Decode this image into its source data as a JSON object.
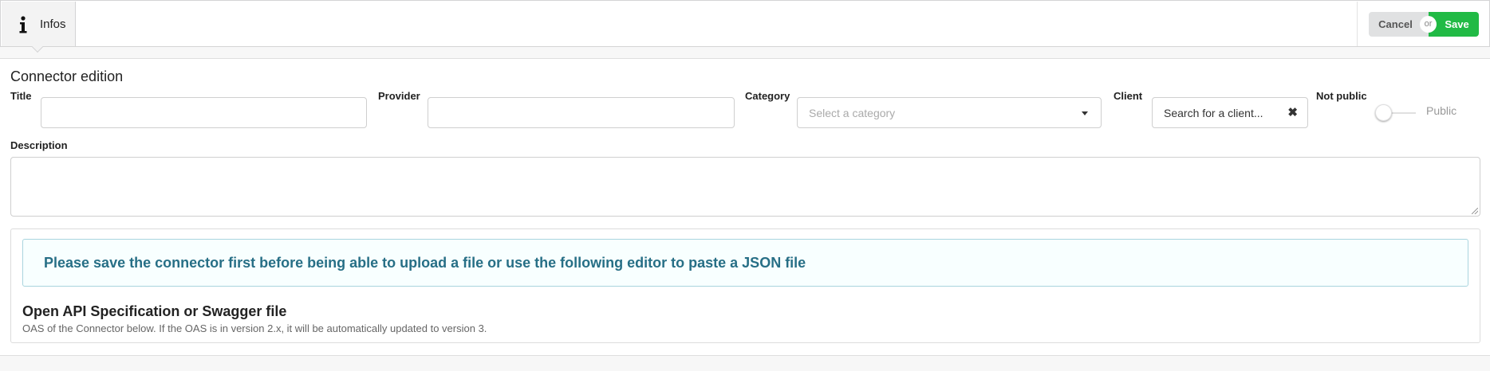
{
  "header": {
    "tabs": [
      {
        "label": "Infos",
        "icon": "info-icon",
        "active": true
      }
    ],
    "actions": {
      "cancel_label": "Cancel",
      "or_label": "or",
      "save_label": "Save"
    }
  },
  "form": {
    "title": "Connector edition",
    "fields": {
      "title": {
        "label": "Title",
        "value": ""
      },
      "provider": {
        "label": "Provider",
        "value": ""
      },
      "category": {
        "label": "Category",
        "placeholder": "Select a category"
      },
      "client": {
        "label": "Client",
        "placeholder": "Search for a client..."
      },
      "visibility": {
        "off_label": "Not public",
        "on_label": "Public",
        "checked": false
      },
      "description": {
        "label": "Description",
        "value": ""
      }
    }
  },
  "oas": {
    "notice": "Please save the connector first before being able to upload a file or use the following editor to paste a JSON file",
    "title": "Open API Specification or Swagger file",
    "description": "OAS of the Connector below. If the OAS is in version 2.x, it will be automatically updated to version 3."
  },
  "colors": {
    "save": "#21ba45",
    "notice_text": "#276f86",
    "notice_bg": "#f8ffff"
  }
}
